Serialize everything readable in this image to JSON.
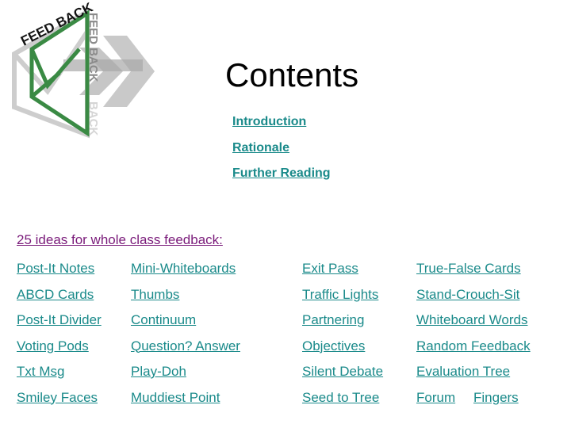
{
  "logo": {
    "arc_text": "FEED BACK",
    "vertical_text_1": "FEED BACK",
    "vertical_text_2": "BACK",
    "colors": {
      "green": "#3a8a44",
      "gray": "#c8c8c8",
      "dark_gray": "#9a9a9a"
    }
  },
  "title": "Contents",
  "toc": [
    {
      "label": "Introduction"
    },
    {
      "label": "Rationale"
    },
    {
      "label": "Further Reading"
    }
  ],
  "ideas_heading": "25 ideas for whole class feedback:",
  "ideas_rows": [
    [
      "Post-It Notes",
      "Mini-Whiteboards",
      "Exit Pass",
      "True-False Cards"
    ],
    [
      "ABCD Cards",
      "Thumbs",
      "Traffic Lights",
      "Stand-Crouch-Sit"
    ],
    [
      "Post-It Divider",
      "Continuum",
      "Partnering",
      "Whiteboard Words"
    ],
    [
      "Voting Pods",
      "Question? Answer",
      "Objectives",
      "Random Feedback"
    ],
    [
      "Txt Msg",
      "Play-Doh",
      "Silent Debate",
      "Evaluation Tree"
    ],
    [
      "Smiley Faces",
      "Muddiest Point",
      "Seed to Tree",
      "Forum",
      "Fingers"
    ]
  ],
  "colors": {
    "link": "#1a8a8a",
    "visited": "#7a1b7a",
    "text": "#000000"
  }
}
